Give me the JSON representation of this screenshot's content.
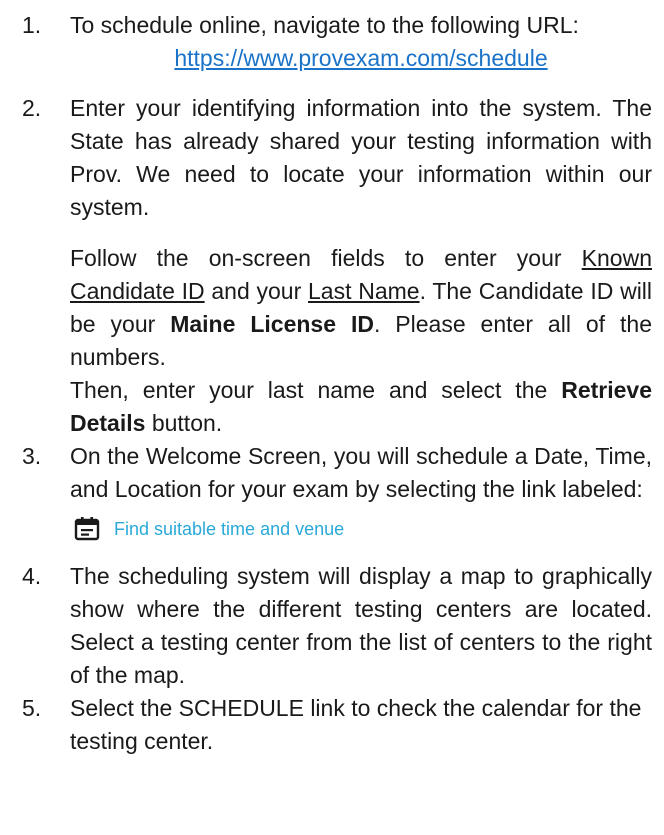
{
  "steps": [
    {
      "number": "1.",
      "line1": "To schedule online, navigate to the following URL:",
      "url": "https://www.provexam.com/schedule"
    },
    {
      "number": "2.",
      "intro": "Enter your identifying information into the system. The State has already shared your testing information with Prov. We need to locate your information within our system.",
      "p2_a": "Follow the on-screen fields to enter your ",
      "known_candidate_id": "Known Candidate ID",
      "p2_b": " and your ",
      "last_name": "Last Name",
      "p2_c": ". The Candidate ID will be your ",
      "maine_license_id": "Maine License ID",
      "p2_d": ". Please enter all of the numbers.",
      "p3_a": "Then, enter your last name and select the ",
      "retrieve_details": "Retrieve Details",
      "p3_b": " button."
    },
    {
      "number": "3.",
      "text": "On the Welcome Screen, you will schedule a Date, Time, and Location for your exam by selecting the link labeled:",
      "link_icon": "calendar-icon",
      "link_text": "Find suitable time and venue"
    },
    {
      "number": "4.",
      "text": "The scheduling system will display a map to graphically show where the different testing centers are located. Select a testing center from the list of centers to the right of the map."
    },
    {
      "number": "5.",
      "text": "Select the SCHEDULE link to check the calendar for the testing center."
    }
  ],
  "colors": {
    "text": "#1a1a1a",
    "url": "#1a73c8",
    "find_link": "#2aa9d8"
  }
}
